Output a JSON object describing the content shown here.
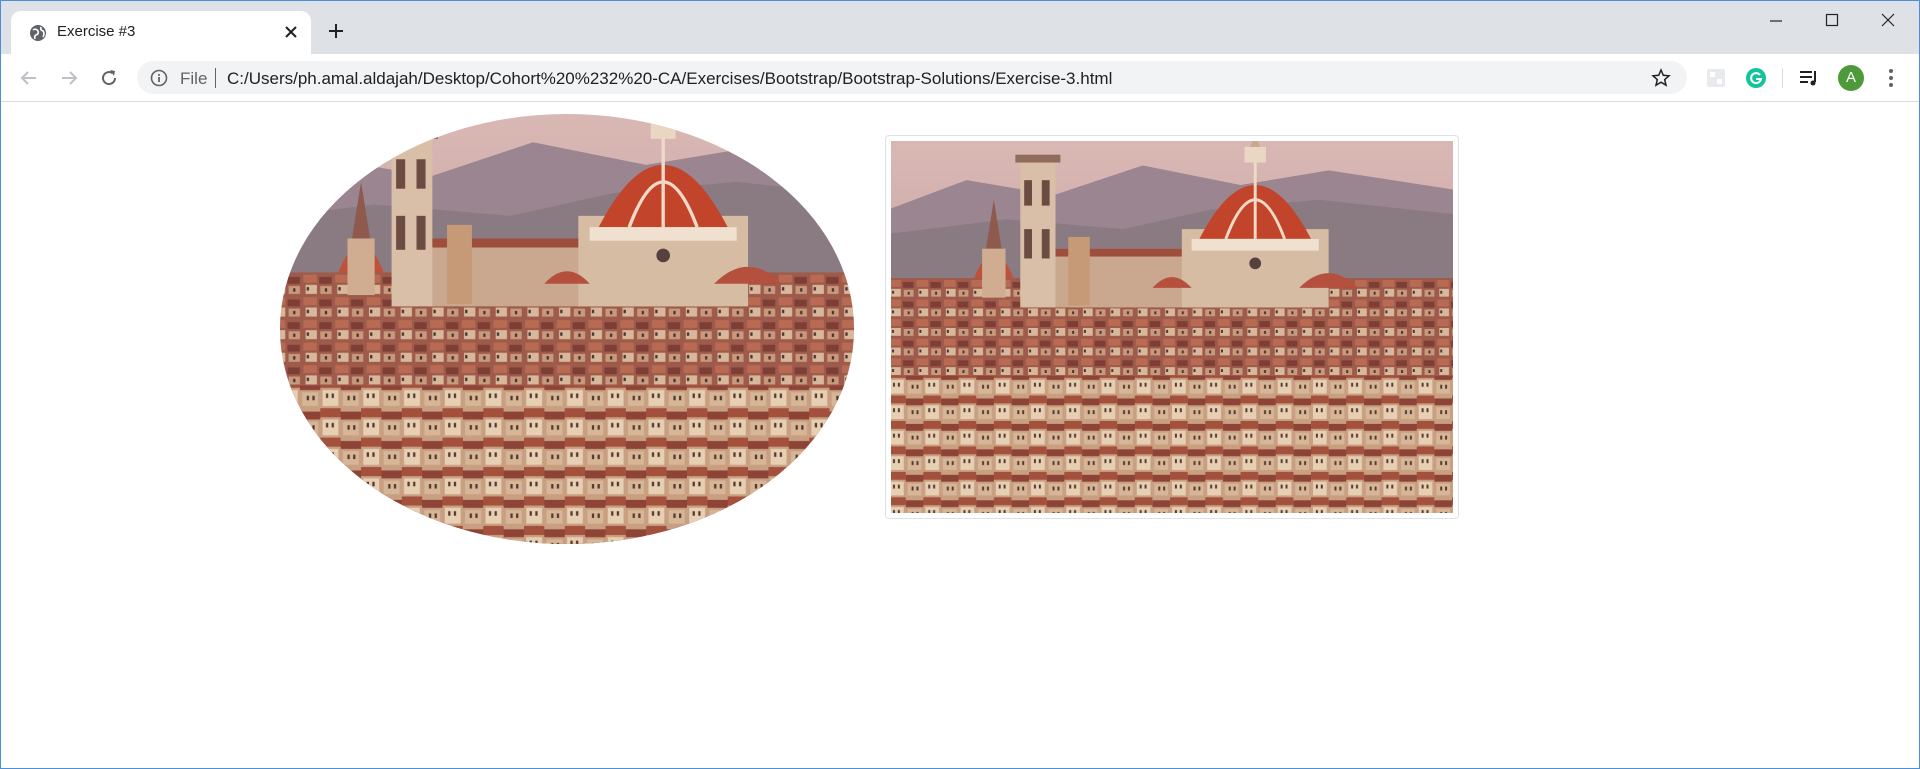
{
  "browser": {
    "tab": {
      "title": "Exercise #3",
      "favicon": "globe-icon",
      "close_icon": "close-icon"
    },
    "new_tab_icon": "plus-icon",
    "window_controls": [
      "minimize-icon",
      "maximize-icon",
      "close-icon"
    ],
    "toolbar": {
      "back_icon": "arrow-left-icon",
      "forward_icon": "arrow-right-icon",
      "reload_icon": "reload-icon",
      "scheme_label": "File",
      "url": "C:/Users/ph.amal.aldajah/Desktop/Cohort%20%232%20-CA/Exercises/Bootstrap/Bootstrap-Solutions/Exercise-3.html",
      "bookmark_icon": "star-icon",
      "extensions": [
        "extension-icon",
        "grammarly-icon",
        "media-control-icon"
      ],
      "profile_initial": "A",
      "menu_icon": "kebab-menu-icon"
    }
  },
  "page": {
    "images": [
      {
        "name": "florence-cathedral-rounded",
        "style": "rounded-circle"
      },
      {
        "name": "florence-cathedral-thumbnail",
        "style": "img-thumbnail"
      }
    ]
  },
  "colors": {
    "tabstrip": "#dee1e6",
    "accent_avatar": "#4e9a3a",
    "grammarly": "#15c39a"
  }
}
